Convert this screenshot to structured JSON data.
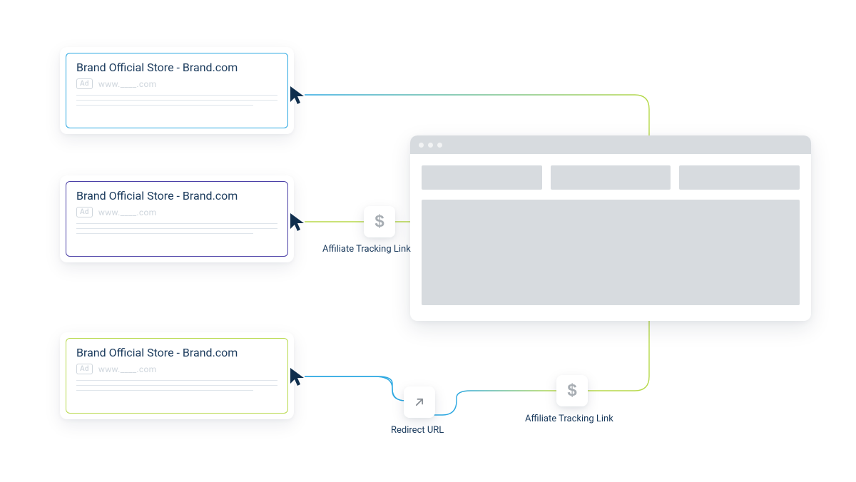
{
  "ads": [
    {
      "title": "Brand Official Store - Brand.com",
      "badge": "Ad",
      "url": "www.____.com",
      "border_color": "#2aa7e1"
    },
    {
      "title": "Brand Official Store - Brand.com",
      "badge": "Ad",
      "url": "www.____.com",
      "border_color": "#4a3fa6"
    },
    {
      "title": "Brand Official Store - Brand.com",
      "badge": "Ad",
      "url": "www.____.com",
      "border_color": "#b7d94a"
    }
  ],
  "labels": {
    "affiliate_tracking_link": "Affiliate Tracking Link",
    "redirect_url": "Redirect URL"
  },
  "icons": {
    "dollar": "$"
  }
}
